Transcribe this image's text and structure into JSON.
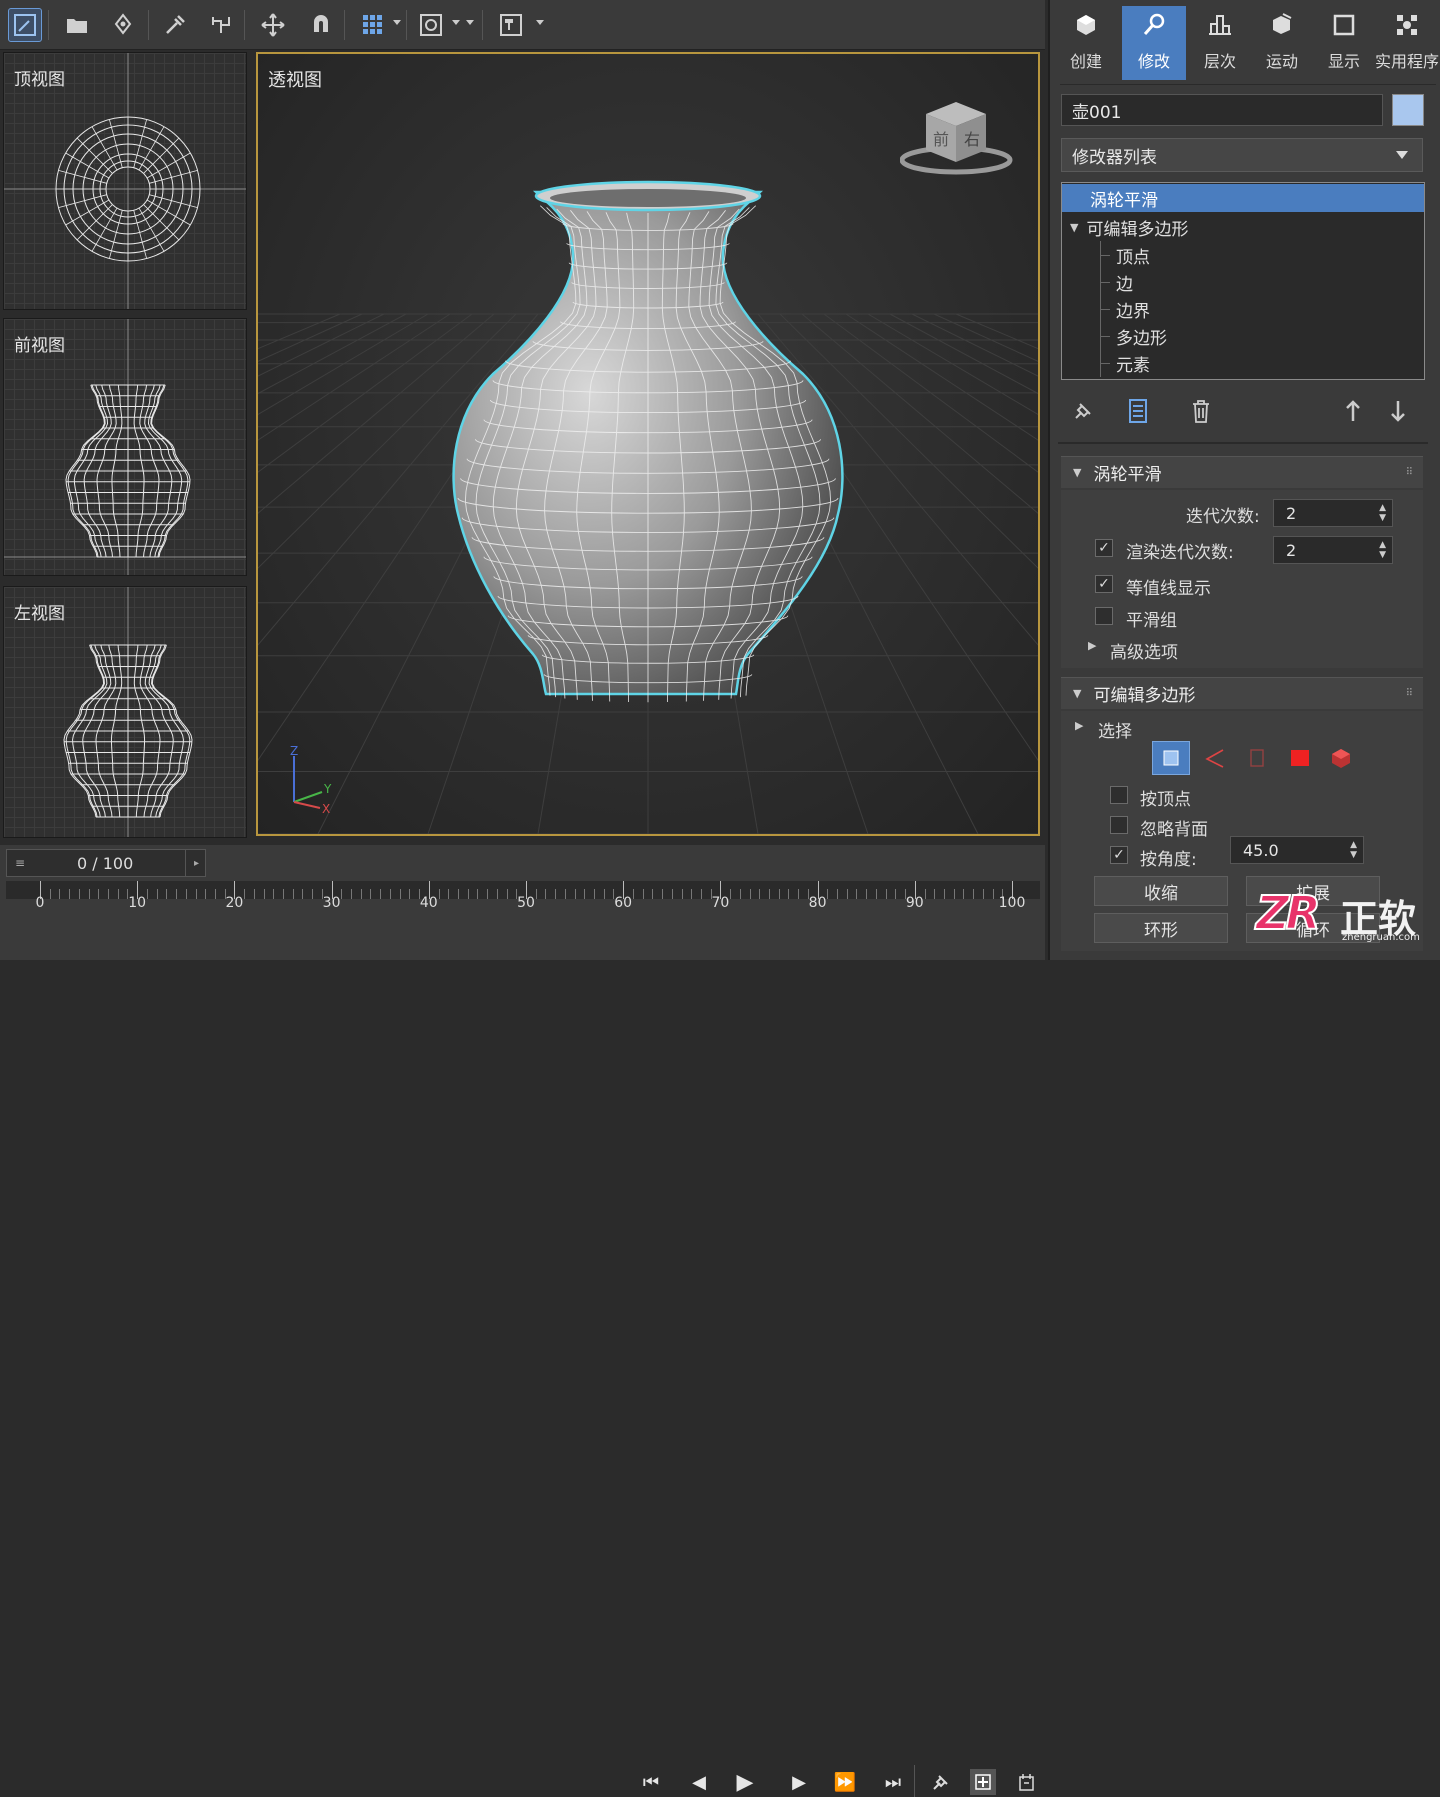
{
  "viewports": {
    "top_label": "顶视图",
    "front_label": "前视图",
    "left_label": "左视图",
    "perspective_label": "透视图",
    "viewcube_front": "前",
    "viewcube_right": "右",
    "axis_z": "Z",
    "axis_y": "Y",
    "axis_x": "X"
  },
  "toolbar": {
    "icons": [
      "select-icon",
      "open-icon",
      "link-icon",
      "eyedropper-icon",
      "snap-icon",
      "move-icon",
      "magnet-icon",
      "grid-icon",
      "circle-select-icon",
      "window-icon"
    ]
  },
  "command_panel": {
    "tabs": [
      {
        "label": "创建",
        "icon": "create-icon"
      },
      {
        "label": "修改",
        "icon": "modify-icon",
        "active": true
      },
      {
        "label": "层次",
        "icon": "hierarchy-icon"
      },
      {
        "label": "运动",
        "icon": "motion-icon"
      },
      {
        "label": "显示",
        "icon": "display-icon"
      },
      {
        "label": "实用程序",
        "icon": "utilities-icon"
      }
    ],
    "object_name": "壶001",
    "object_color": "#a9c7ee",
    "modifier_list": "修改器列表",
    "stack": {
      "turbosmooth": "涡轮平滑",
      "editable_poly": "可编辑多边形",
      "sub": [
        "顶点",
        "边",
        "边界",
        "多边形",
        "元素"
      ]
    },
    "turbosmooth_rollout": {
      "title": "涡轮平滑",
      "iterations_label": "迭代次数:",
      "iterations_value": "2",
      "render_iters_label": "渲染迭代次数:",
      "render_iters_value": "2",
      "render_iters_checked": true,
      "isoline_label": "等值线显示",
      "isoline_checked": true,
      "smooth_groups_label": "平滑组",
      "smooth_groups_checked": false,
      "advanced_label": "高级选项"
    },
    "poly_rollout": {
      "title": "可编辑多边形",
      "selection_label": "选择",
      "by_vertex": "按顶点",
      "ignore_backface": "忽略背面",
      "by_angle": "按角度:",
      "by_angle_checked": true,
      "angle_value": "45.0",
      "shrink": "收缩",
      "grow": "扩展",
      "ring": "环形",
      "loop": "循环"
    }
  },
  "timeline": {
    "frame_display": "0 / 100",
    "ticks": [
      "0",
      "10",
      "20",
      "30",
      "40",
      "50",
      "60",
      "70",
      "80",
      "90",
      "100"
    ]
  },
  "watermark": {
    "logo": "ZR",
    "text": "正软",
    "url": "zhengruan.com"
  },
  "colors": {
    "accent": "#4a7dbf",
    "viewport_border": "#b8963e",
    "selection_outline": "#5fd4e6"
  }
}
